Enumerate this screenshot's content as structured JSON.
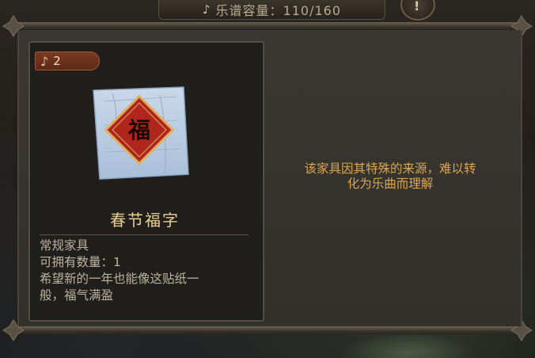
{
  "topbar": {
    "note_icon": "music-note-icon",
    "label": "乐谱容量：110/160",
    "alert_label": "!"
  },
  "item": {
    "cost_icon": "music-note-icon",
    "cost": "2",
    "image_icon": "fu-sticker-icon",
    "image_character": "福",
    "name": "春节福字",
    "category": "常规家具",
    "quantity": "可拥有数量：1",
    "flavor_line1": "希望新的一年也能像这贴纸一",
    "flavor_line2": "般，福气满盈"
  },
  "description": {
    "line1": "该家具因其特殊的来源，难以转",
    "line2": "化为乐曲而理解"
  },
  "colors": {
    "accent_gold": "#d9a650",
    "title_gold": "#e8cf93",
    "body_text": "#bdb2a0",
    "badge_red": "#7a3a22",
    "fu_red": "#b0251c"
  }
}
